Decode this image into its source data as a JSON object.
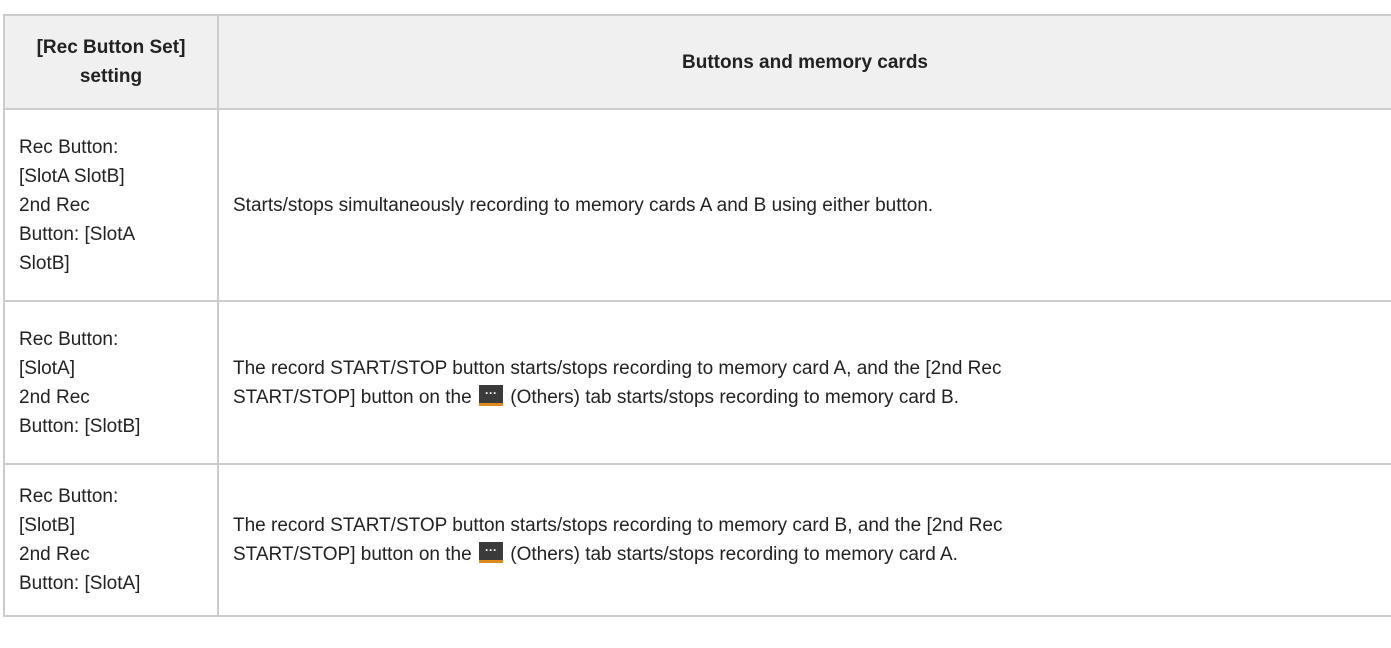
{
  "table": {
    "headers": [
      "[Rec Button Set] setting",
      "Buttons and memory cards"
    ],
    "rows": [
      {
        "setting_lines": [
          "Rec Button:",
          "[SlotA SlotB]",
          "2nd Rec",
          "Button: [SlotA",
          "SlotB]"
        ],
        "description": "Starts/stops simultaneously recording to memory cards A and B using either button."
      },
      {
        "setting_lines": [
          "Rec Button:",
          "[SlotA]",
          "2nd Rec",
          "Button: [SlotB]"
        ],
        "description_line1": "The record START/STOP button starts/stops recording to memory card A, and the [2nd Rec",
        "description_pre_icon": "START/STOP] button on the ",
        "description_post_icon": " (Others) tab starts/stops recording to memory card B."
      },
      {
        "setting_lines": [
          "Rec Button:",
          "[SlotB]",
          "2nd Rec",
          "Button: [SlotA]"
        ],
        "description_line1": "The record START/STOP button starts/stops recording to memory card B, and the [2nd Rec",
        "description_pre_icon": "START/STOP] button on the ",
        "description_post_icon": " (Others) tab starts/stops recording to memory card A."
      }
    ],
    "others_icon": {
      "name": "others-tab-icon",
      "glyph": "···",
      "colors": {
        "background": "#3a3a3a",
        "underline": "#e08a1e"
      }
    }
  }
}
